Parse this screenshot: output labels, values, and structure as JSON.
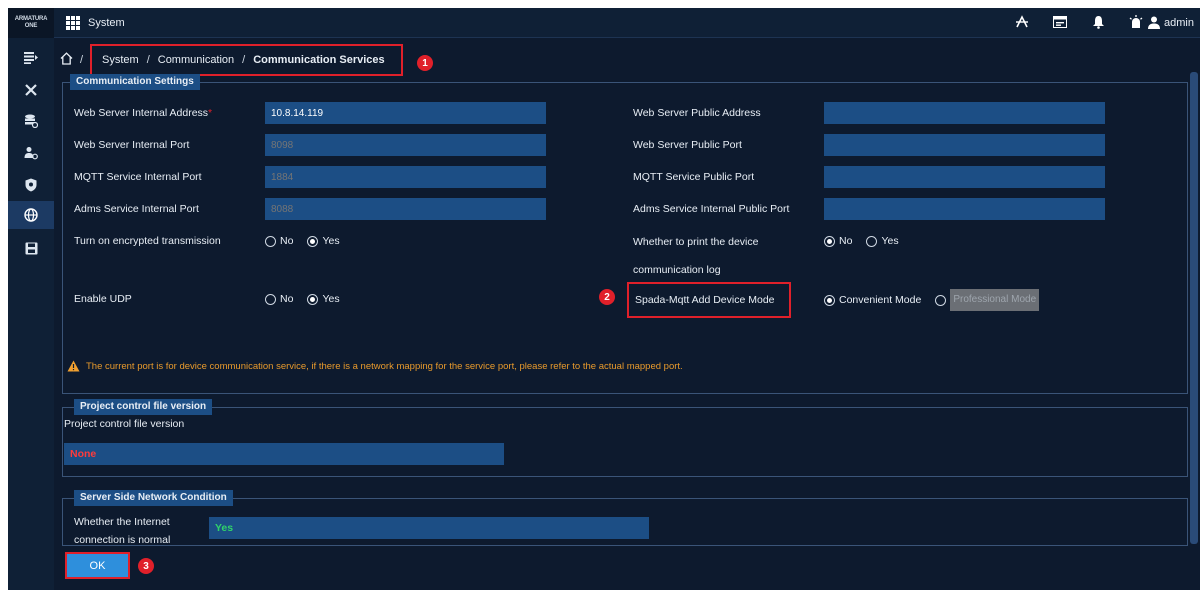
{
  "app": {
    "logo_line1": "ARMATURA",
    "logo_line2": "ONE",
    "title": "System",
    "user": "admin"
  },
  "topbar_icons": [
    "signal-icon",
    "window-icon",
    "bell-icon",
    "alarm-icon",
    "user-icon"
  ],
  "sidebar_icons": [
    "menu-list-icon",
    "tools-icon",
    "database-icon",
    "people-icon",
    "shield-icon",
    "network-globe-icon",
    "save-disk-icon"
  ],
  "breadcrumb": {
    "items": [
      "System",
      "Communication",
      "Communication Services"
    ],
    "separator": "/"
  },
  "markers": [
    "1",
    "2",
    "3"
  ],
  "communication_settings": {
    "title": "Communication Settings",
    "web_internal_address_label": "Web Server Internal Address",
    "required_mark": "*",
    "web_internal_address_value": "10.8.14.119",
    "web_internal_port_label": "Web Server Internal Port",
    "web_internal_port_placeholder": "8098",
    "mqtt_internal_port_label": "MQTT Service Internal Port",
    "mqtt_internal_port_placeholder": "1884",
    "adms_internal_port_label": "Adms Service Internal Port",
    "adms_internal_port_placeholder": "8088",
    "web_public_address_label": "Web Server Public Address",
    "web_public_port_label": "Web Server Public Port",
    "mqtt_public_port_label": "MQTT Service Public Port",
    "adms_public_port_label": "Adms Service Internal Public Port",
    "encrypted_label": "Turn on encrypted transmission",
    "print_log_label_line1": "Whether to print the device",
    "print_log_label_line2": "communication log",
    "enable_udp_label": "Enable UDP",
    "mqtt_mode_label": "Spada-Mqtt Add Device Mode",
    "option_no": "No",
    "option_yes": "Yes",
    "convenient_mode": "Convenient Mode",
    "professional_mode": "Professional Mode",
    "warning": "The current port is for device communication service, if there is a network mapping for the service port, please refer to the actual mapped port."
  },
  "project_control": {
    "title": "Project control file version",
    "label": "Project control file version",
    "value": "None"
  },
  "network_condition": {
    "title": "Server Side Network Condition",
    "label_line1": "Whether the Internet",
    "label_line2": "connection is normal",
    "value": "Yes"
  },
  "ok_label": "OK",
  "colors": {
    "background": "#0d1a2e",
    "input": "#1c4e85",
    "annotation_red": "#e0202a",
    "warning_orange": "#e89a2c",
    "none_red": "#ff3b3b",
    "yes_green": "#2fd36a",
    "button_blue": "#2e8fdc"
  }
}
